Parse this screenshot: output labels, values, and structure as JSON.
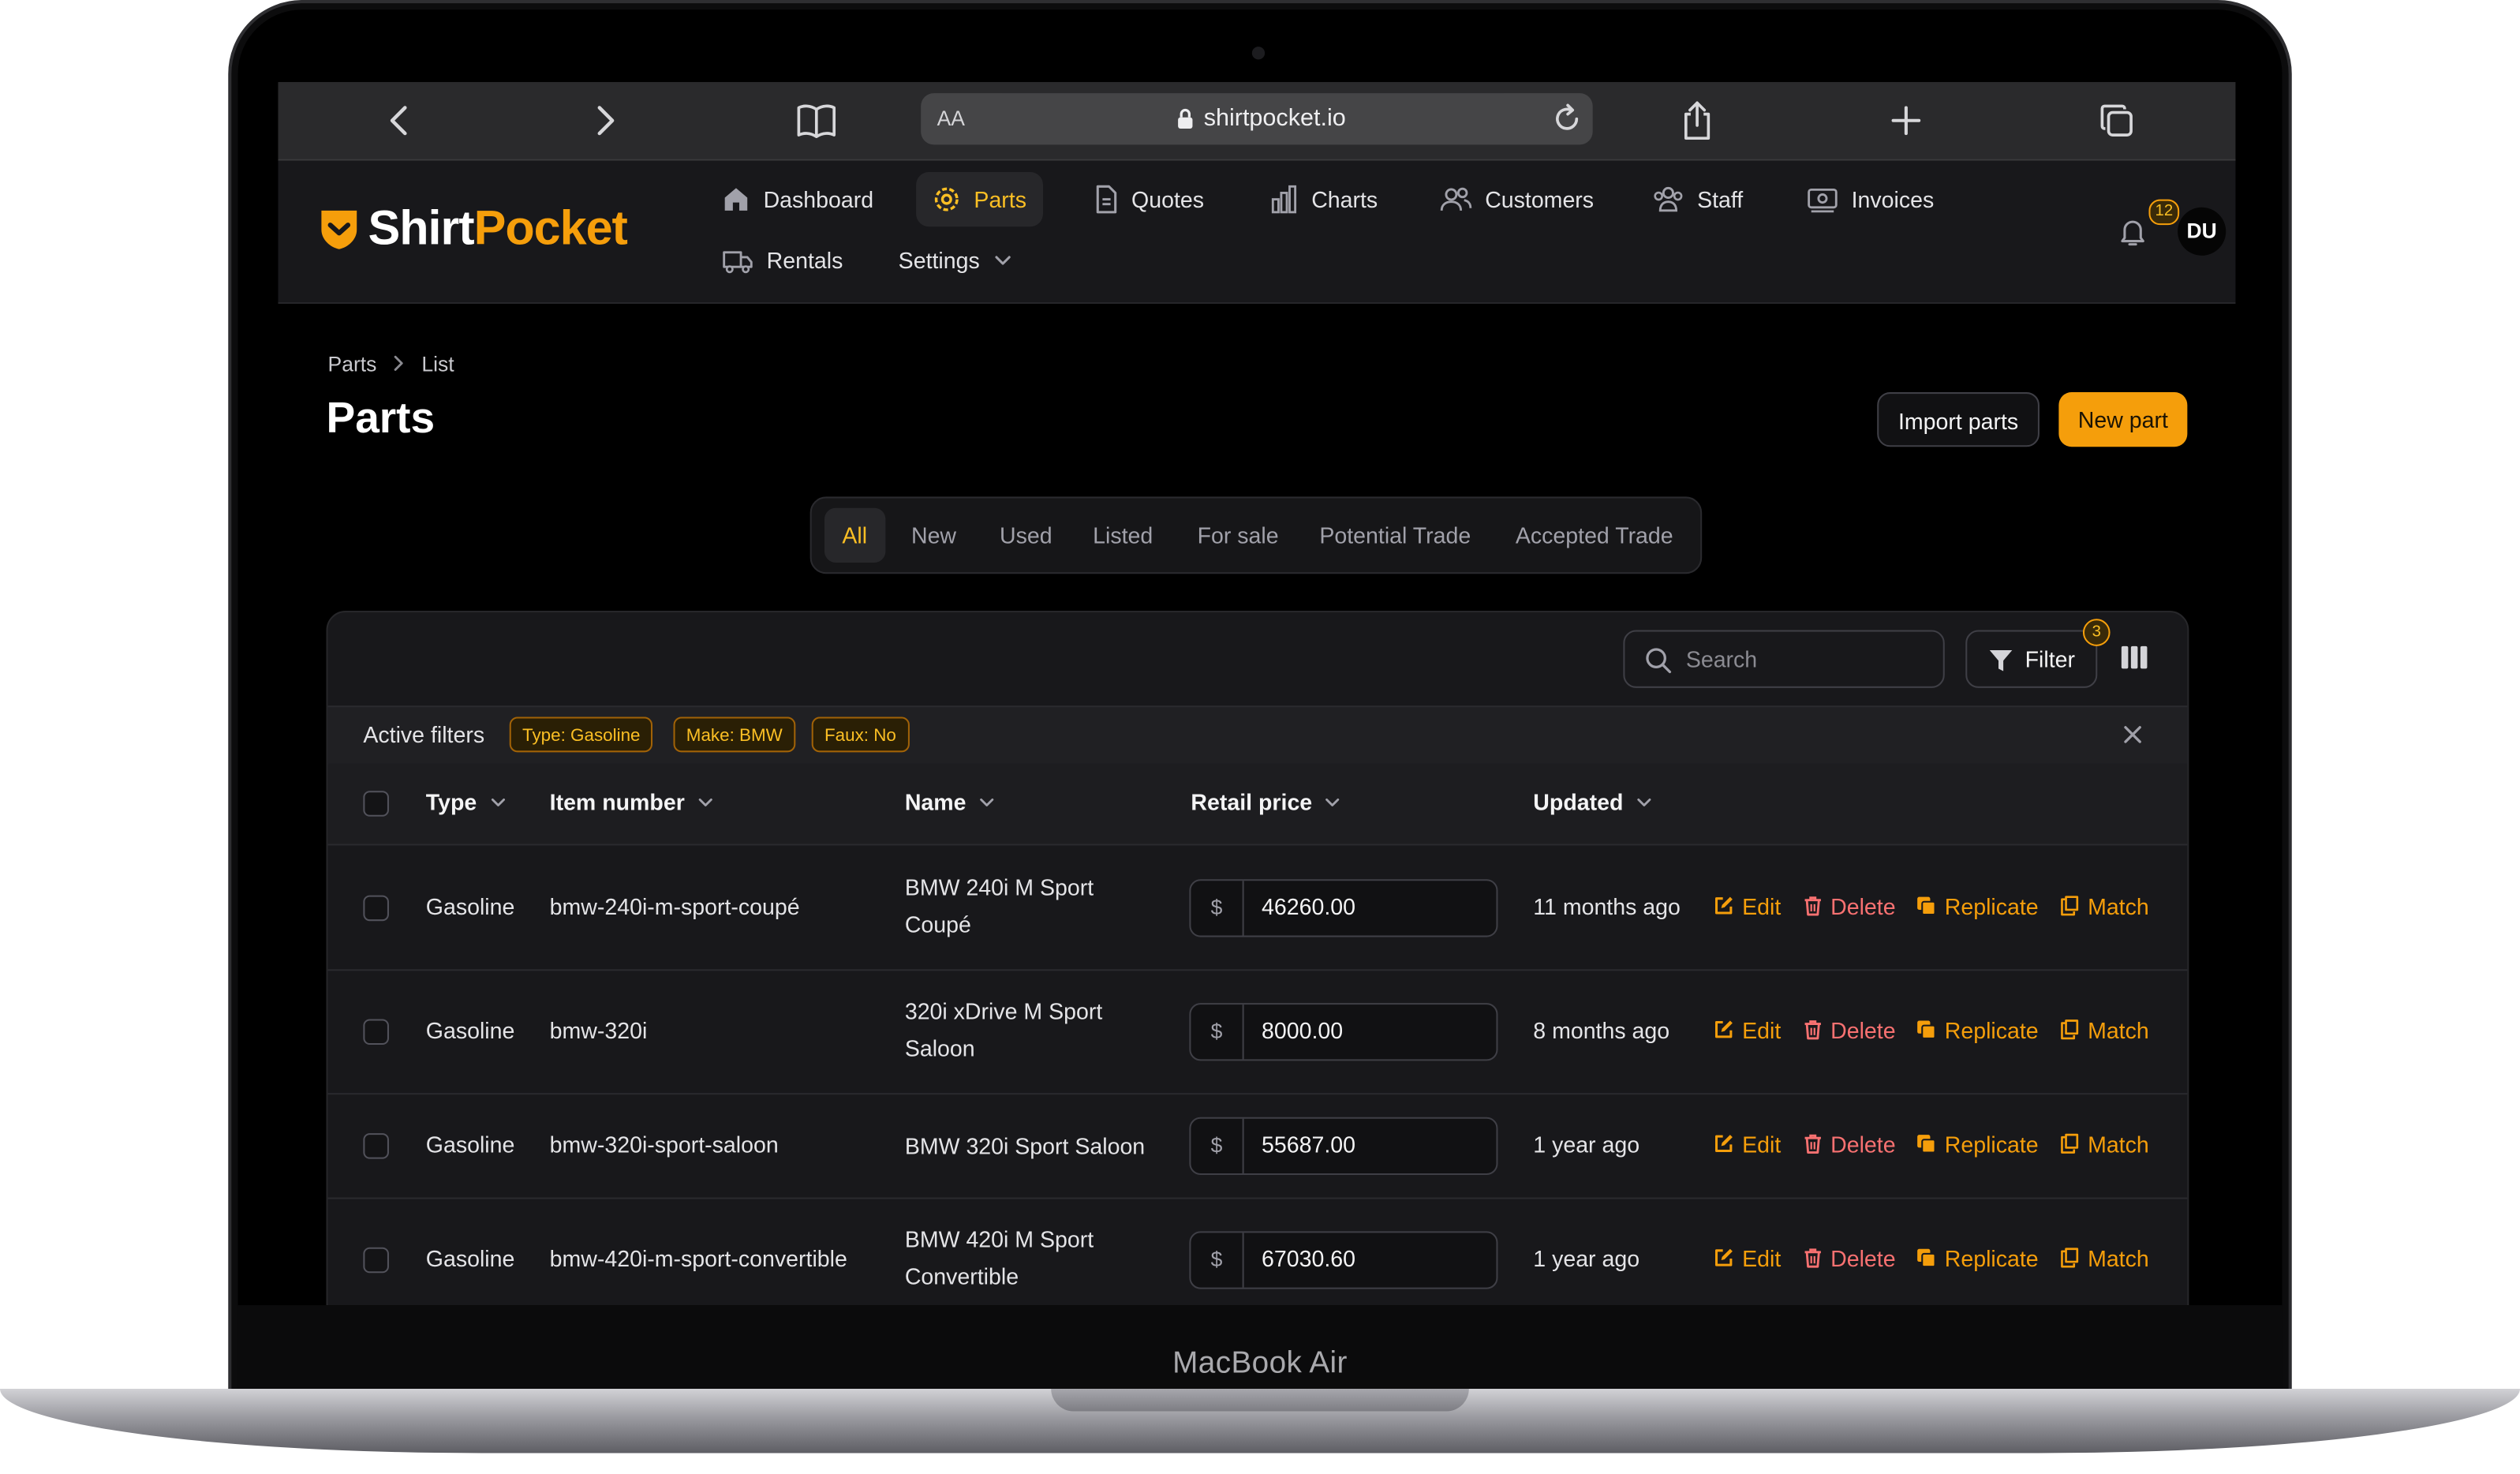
{
  "device_label": "MacBook Air",
  "browser": {
    "text_size_label": "AA",
    "url": "shirtpocket.io",
    "icons": [
      "back-icon",
      "forward-icon",
      "bookmarks-icon",
      "lock-icon",
      "reload-icon",
      "share-icon",
      "new-tab-icon",
      "tabs-icon"
    ]
  },
  "app": {
    "logo_part1": "Shirt",
    "logo_part2": "Pocket",
    "nav": [
      {
        "label": "Dashboard",
        "icon": "home-icon"
      },
      {
        "label": "Parts",
        "icon": "gear-icon",
        "active": true
      },
      {
        "label": "Quotes",
        "icon": "document-icon"
      },
      {
        "label": "Charts",
        "icon": "bar-chart-icon"
      },
      {
        "label": "Customers",
        "icon": "users-icon"
      },
      {
        "label": "Staff",
        "icon": "group-icon"
      },
      {
        "label": "Invoices",
        "icon": "money-icon"
      },
      {
        "label": "Rentals",
        "icon": "truck-icon"
      },
      {
        "label": "Settings",
        "icon": "chevron-down-icon"
      }
    ],
    "notification_count": "12",
    "avatar_initials": "DU",
    "accent_color": "#f59e0b"
  },
  "page": {
    "breadcrumb": [
      "Parts",
      "List"
    ],
    "title": "Parts",
    "import_label": "Import parts",
    "new_label": "New part"
  },
  "tabs": [
    "All",
    "New",
    "Used",
    "Listed",
    "For sale",
    "Potential Trade",
    "Accepted Trade"
  ],
  "active_tab": "All",
  "table": {
    "search_placeholder": "Search",
    "filter_label": "Filter",
    "filter_count": "3",
    "active_filters_label": "Active filters",
    "active_filters": [
      "Type: Gasoline",
      "Make: BMW",
      "Faux: No"
    ],
    "columns": [
      "Type",
      "Item number",
      "Name",
      "Retail price",
      "Updated"
    ],
    "currency_symbol": "$",
    "actions": [
      "Edit",
      "Delete",
      "Replicate",
      "Match"
    ],
    "rows": [
      {
        "type": "Gasoline",
        "item_number": "bmw-240i-m-sport-coupé",
        "name": "BMW 240i M Sport Coupé",
        "price": "46260.00",
        "updated": "11 months ago"
      },
      {
        "type": "Gasoline",
        "item_number": "bmw-320i",
        "name": "320i xDrive M Sport Saloon",
        "price": "8000.00",
        "updated": "8 months ago"
      },
      {
        "type": "Gasoline",
        "item_number": "bmw-320i-sport-saloon",
        "name": "BMW 320i Sport Saloon",
        "price": "55687.00",
        "updated": "1 year ago"
      },
      {
        "type": "Gasoline",
        "item_number": "bmw-420i-m-sport-convertible",
        "name": "BMW 420i M Sport Convertible",
        "price": "67030.60",
        "updated": "1 year ago"
      }
    ]
  }
}
